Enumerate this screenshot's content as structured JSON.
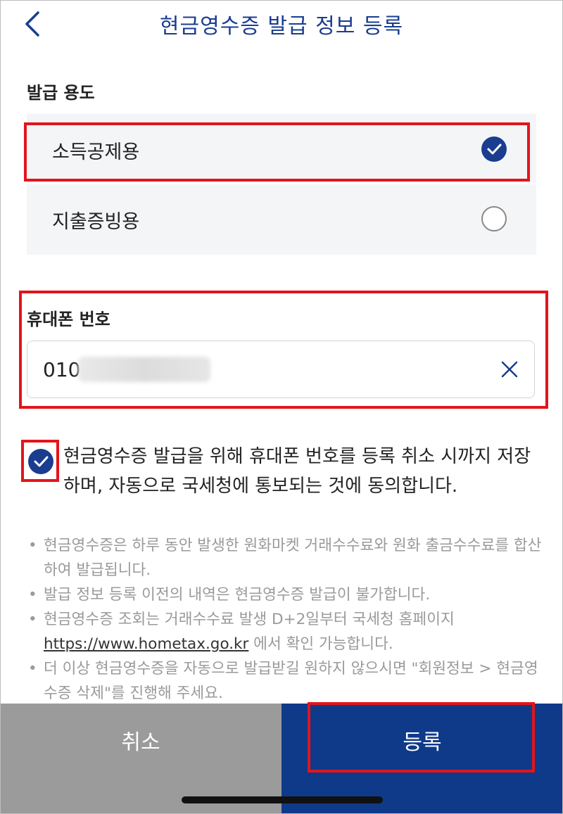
{
  "header": {
    "title": "현금영수증 발급 정보 등록",
    "back_icon": "chevron-left-icon"
  },
  "usage": {
    "label": "발급 용도",
    "options": [
      {
        "label": "소득공제용",
        "selected": true
      },
      {
        "label": "지출증빙용",
        "selected": false
      }
    ]
  },
  "phone": {
    "label": "휴대폰 번호",
    "value": "010",
    "clear_icon": "close-icon"
  },
  "agreement": {
    "checked": true,
    "text": "현금영수증 발급을 위해 휴대폰 번호를 등록 취소 시까지 저장하며, 자동으로 국세청에 통보되는 것에 동의합니다."
  },
  "notes": {
    "bullet": "•",
    "items": [
      "현금영수증은 하루 동안 발생한 원화마켓 거래수수료와 원화 출금수수료를 합산하여 발급됩니다.",
      "발급 정보 등록 이전의 내역은 현금영수증 발급이 불가합니다."
    ],
    "hometax_before": "현금영수증 조회는 거래수수료 발생 D+2일부터 국세청 홈페이지 ",
    "hometax_link": "https://www.hometax.go.kr",
    "hometax_after": " 에서 확인 가능합니다.",
    "last": "더 이상 현금영수증을 자동으로 발급받길 원하지 않으시면 \"회원정보 > 현금영수증 삭제\"를 진행해 주세요."
  },
  "buttons": {
    "cancel": "취소",
    "register": "등록"
  },
  "colors": {
    "primary": "#1a3d8f",
    "highlight": "#e2151b",
    "cancel_bg": "#9b9b9b"
  }
}
